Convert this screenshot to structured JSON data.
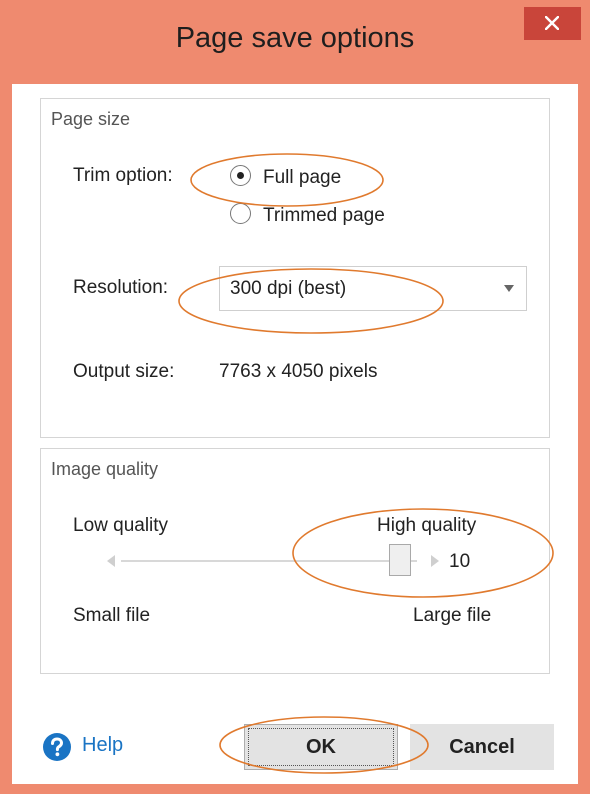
{
  "window": {
    "title": "Page save options",
    "colors": {
      "frame": "#ef8a6f",
      "close_button": "#c9453a",
      "annotation": "#e07a2e",
      "link": "#1a74c4"
    }
  },
  "page_size": {
    "legend": "Page size",
    "trim_option_label": "Trim option:",
    "options": [
      {
        "label": "Full page",
        "selected": true
      },
      {
        "label": "Trimmed page",
        "selected": false
      }
    ],
    "resolution_label": "Resolution:",
    "resolution_value": "300 dpi (best)",
    "output_size_label": "Output size:",
    "output_size_value": "7763 x 4050 pixels"
  },
  "image_quality": {
    "legend": "Image quality",
    "low_label": "Low quality",
    "high_label": "High quality",
    "value": "10",
    "small_label": "Small file",
    "large_label": "Large file"
  },
  "footer": {
    "help_label": "Help",
    "ok_label": "OK",
    "cancel_label": "Cancel"
  },
  "icons": [
    "close-icon",
    "help-icon",
    "dropdown-arrow-icon",
    "slider-left-arrow-icon",
    "slider-right-arrow-icon"
  ]
}
